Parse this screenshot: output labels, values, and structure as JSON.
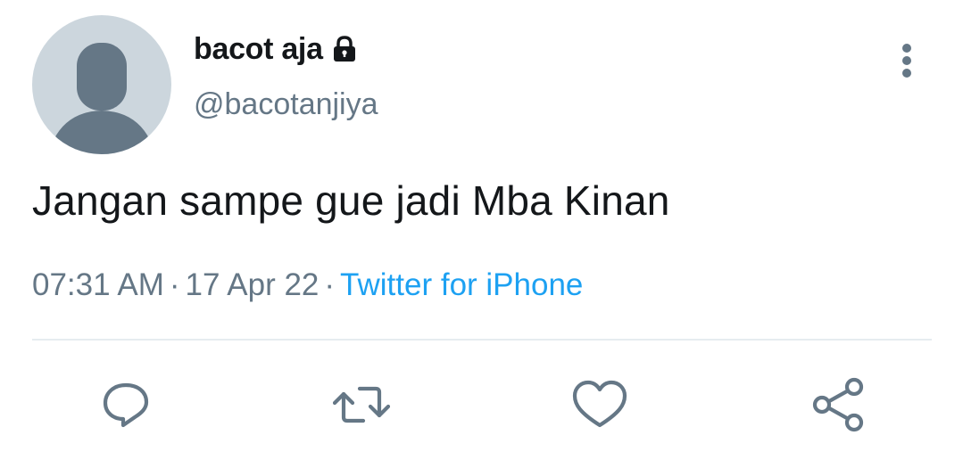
{
  "tweet": {
    "display_name": "bacot aja",
    "handle": "@bacotanjiya",
    "text": "Jangan sampe gue jadi Mba Kinan",
    "time": "07:31 AM",
    "date": "17 Apr 22",
    "separator": "·",
    "source": "Twitter for iPhone",
    "protected_icon": "lock-icon",
    "avatar": "default-avatar"
  },
  "actions": [
    {
      "name": "reply",
      "icon": "reply-icon"
    },
    {
      "name": "retweet",
      "icon": "retweet-icon"
    },
    {
      "name": "like",
      "icon": "heart-icon"
    },
    {
      "name": "share",
      "icon": "share-icon"
    }
  ],
  "menu": {
    "icon": "more-vertical-icon"
  },
  "colors": {
    "text": "#14171a",
    "secondary": "#657786",
    "link": "#1da1f2",
    "avatar_bg": "#ccd6dd",
    "avatar_fg": "#657786",
    "divider": "#e6ecf0"
  }
}
